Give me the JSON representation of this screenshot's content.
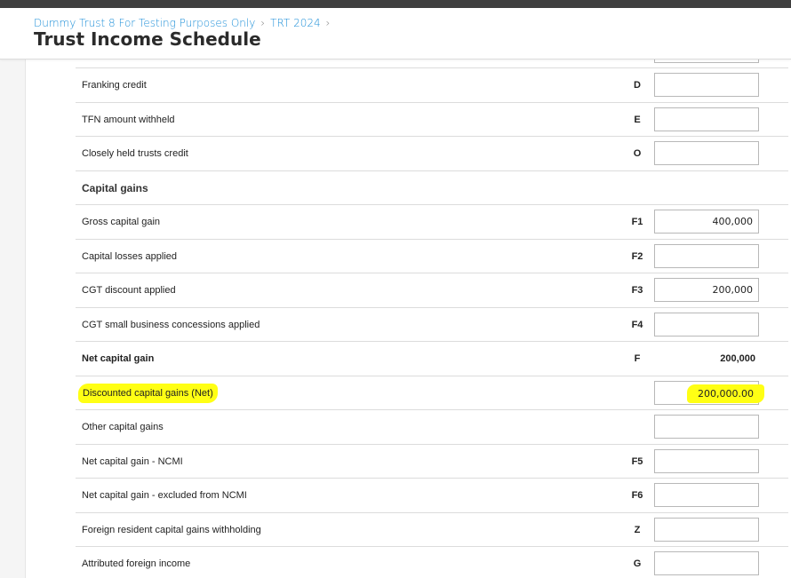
{
  "header": {
    "breadcrumb": [
      "Dummy Trust 8 For Testing Purposes Only",
      "TRT 2024"
    ],
    "separator": "›",
    "title": "Trust Income Schedule"
  },
  "rows": [
    {
      "label": "",
      "code": "",
      "value": ""
    },
    {
      "label": "Franking credit",
      "code": "D",
      "value": ""
    },
    {
      "label": "TFN amount withheld",
      "code": "E",
      "value": ""
    },
    {
      "label": "Closely held trusts credit",
      "code": "O",
      "value": ""
    },
    {
      "label": "Capital gains"
    },
    {
      "label": "Gross capital gain",
      "code": "F1",
      "value": "400,000"
    },
    {
      "label": "Capital losses applied",
      "code": "F2",
      "value": ""
    },
    {
      "label": "CGT discount applied",
      "code": "F3",
      "value": "200,000"
    },
    {
      "label": "CGT small business concessions applied",
      "code": "F4",
      "value": ""
    },
    {
      "label": "Net capital gain",
      "code": "F",
      "value": "200,000"
    },
    {
      "label": "Discounted capital gains (Net)",
      "code": "",
      "value": "200,000.00"
    },
    {
      "label": "Other capital gains",
      "code": "",
      "value": ""
    },
    {
      "label": "Net capital gain - NCMI",
      "code": "F5",
      "value": ""
    },
    {
      "label": "Net capital gain - excluded from NCMI",
      "code": "F6",
      "value": ""
    },
    {
      "label": "Foreign resident capital gains withholding",
      "code": "Z",
      "value": ""
    },
    {
      "label": "Attributed foreign income",
      "code": "G",
      "value": ""
    }
  ],
  "colors": {
    "link": "#1d8fd8",
    "highlight": "#ffff14",
    "topbar": "#3f3f3f"
  }
}
